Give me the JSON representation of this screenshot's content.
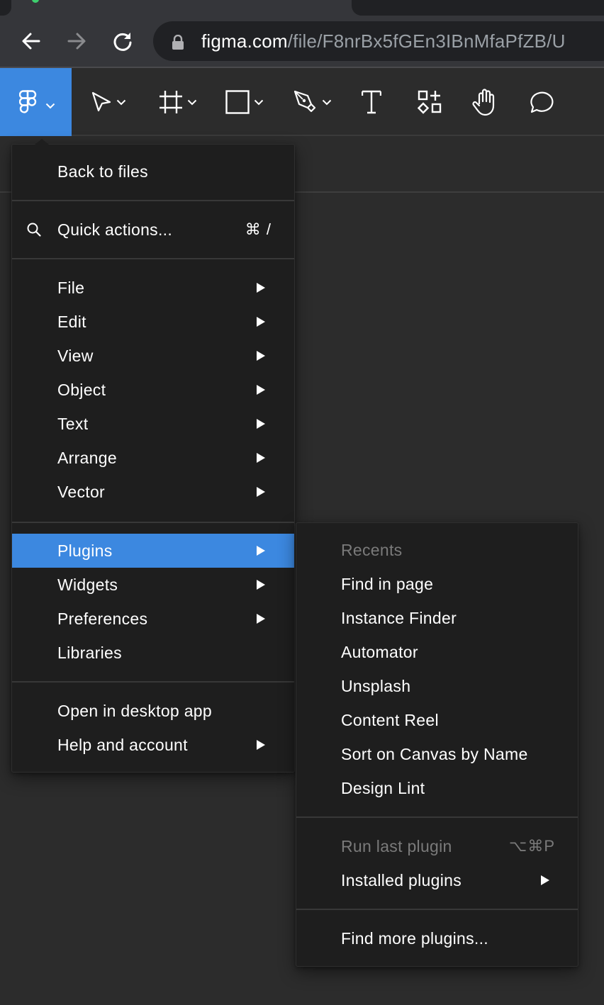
{
  "browser": {
    "url_host": "figma.com",
    "url_path": "/file/F8nrBx5fGEn3IBnMfaPfZB/U",
    "back_icon": "arrow-left-icon",
    "forward_icon": "arrow-right-icon",
    "reload_icon": "reload-icon",
    "lock_icon": "lock-icon"
  },
  "toolbar": {
    "tools": [
      {
        "name": "main-menu",
        "icon": "figma-logo-icon",
        "has_dropdown": true,
        "active": true
      },
      {
        "name": "move",
        "icon": "move-cursor-icon",
        "has_dropdown": true
      },
      {
        "name": "frame",
        "icon": "frame-icon",
        "has_dropdown": true
      },
      {
        "name": "shape",
        "icon": "rectangle-icon",
        "has_dropdown": true
      },
      {
        "name": "pen",
        "icon": "pen-icon",
        "has_dropdown": true
      },
      {
        "name": "text",
        "icon": "text-icon",
        "has_dropdown": false
      },
      {
        "name": "resources",
        "icon": "resources-icon",
        "has_dropdown": false
      },
      {
        "name": "hand",
        "icon": "hand-icon",
        "has_dropdown": false
      },
      {
        "name": "comment",
        "icon": "comment-icon",
        "has_dropdown": false
      }
    ],
    "accent_color": "#3c88e0"
  },
  "main_menu": {
    "back_to_files": "Back to files",
    "quick_actions": {
      "label": "Quick actions...",
      "shortcut": "⌘ /"
    },
    "groups": [
      [
        {
          "label": "File",
          "submenu": true
        },
        {
          "label": "Edit",
          "submenu": true
        },
        {
          "label": "View",
          "submenu": true
        },
        {
          "label": "Object",
          "submenu": true
        },
        {
          "label": "Text",
          "submenu": true
        },
        {
          "label": "Arrange",
          "submenu": true
        },
        {
          "label": "Vector",
          "submenu": true
        }
      ],
      [
        {
          "label": "Plugins",
          "submenu": true,
          "active": true
        },
        {
          "label": "Widgets",
          "submenu": true
        },
        {
          "label": "Preferences",
          "submenu": true
        },
        {
          "label": "Libraries",
          "submenu": false
        }
      ],
      [
        {
          "label": "Open in desktop app",
          "submenu": false
        },
        {
          "label": "Help and account",
          "submenu": true
        }
      ]
    ]
  },
  "plugins_menu": {
    "recents_header": "Recents",
    "recents": [
      "Find in page",
      "Instance Finder",
      "Automator",
      "Unsplash",
      "Content Reel",
      "Sort on Canvas by Name",
      "Design Lint"
    ],
    "run_last": {
      "label": "Run last plugin",
      "shortcut": "⌥⌘P",
      "disabled": true
    },
    "installed": {
      "label": "Installed plugins",
      "submenu": true
    },
    "find_more": "Find more plugins..."
  }
}
